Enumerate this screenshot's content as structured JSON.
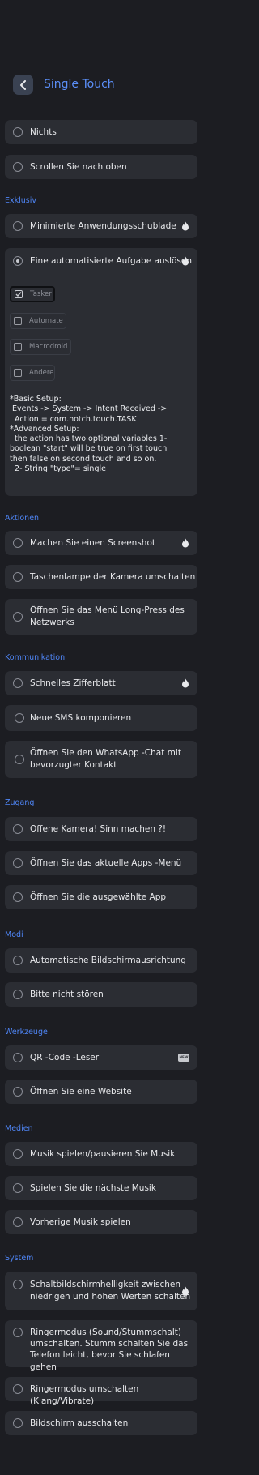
{
  "header": {
    "title": "Single Touch"
  },
  "items": {
    "nichts": "Nichts",
    "scroll_top": "Scrollen Sie nach oben",
    "minimized_drawer": "Minimierte Anwendungsschublade",
    "automated_task": "Eine automatisierte Aufgabe auslösen",
    "screenshot": "Machen Sie einen Screenshot",
    "flashlight": "Taschenlampe der Kamera umschalten",
    "network_menu_l1": "Öffnen Sie das Menü Long-Press des",
    "network_menu_l2": "Netzwerks",
    "quick_dial": "Schnelles Zifferblatt",
    "new_sms": "Neue SMS komponieren",
    "whatsapp_l1": "Öffnen Sie den WhatsApp -Chat mit",
    "whatsapp_l2": "bevorzugter Kontakt",
    "camera": "Offene Kamera! Sinn machen ?!",
    "current_apps": "Öffnen Sie das aktuelle Apps -Menü",
    "selected_app": "Öffnen Sie die ausgewählte App",
    "auto_rotate": "Automatische Bildschirmausrichtung",
    "dnd": "Bitte nicht stören",
    "qr": "QR -Code -Leser",
    "website": "Öffnen Sie eine Website",
    "music_play": "Musik spielen/pausieren Sie Musik",
    "music_next": "Spielen Sie die nächste Musik",
    "music_prev": "Vorherige Musik spielen",
    "brightness_l1": "Schaltbildschirmhelligkeit zwischen",
    "brightness_l2": "niedrigen und hohen Werten schalten",
    "ringer_silent_l1": "Ringermodus (Sound/Stummschalt)",
    "ringer_silent_l2": "umschalten. Stumm schalten Sie das",
    "ringer_silent_l3": "Telefon leicht, bevor Sie schlafen gehen",
    "ringer_vibrate": "Ringermodus umschalten (Klang/Vibrate)",
    "screen_off": "Bildschirm ausschalten"
  },
  "sections": {
    "exklusiv": "Exklusiv",
    "aktionen": "Aktionen",
    "kommunikation": "Kommunikation",
    "zugang": "Zugang",
    "modi": "Modi",
    "werkzeuge": "Werkzeuge",
    "medien": "Medien",
    "system": "System"
  },
  "automation_apps": {
    "tasker": "Tasker",
    "automate": "Automate",
    "macrodroid": "Macrodroid",
    "andere": "Andere",
    "tasker_checked": true
  },
  "setup_text": "*Basic Setup:\n Events -> System -> Intent Received ->\n  Action = com.notch.touch.TASK\n*Advanced Setup:\n  the action has two optional variables 1-\nboolean \"start\" will be true on first touch\nthen false on second touch and so on.\n  2- String \"type\"= single",
  "badges": {
    "qr_badge": "NEW"
  },
  "colors": {
    "accent": "#4f86f7",
    "background": "#1c1d22",
    "card": "#2b2d33",
    "flame": "#e8e9ec"
  },
  "selected_option": "Eine automatisierte Aufgabe auslösen"
}
